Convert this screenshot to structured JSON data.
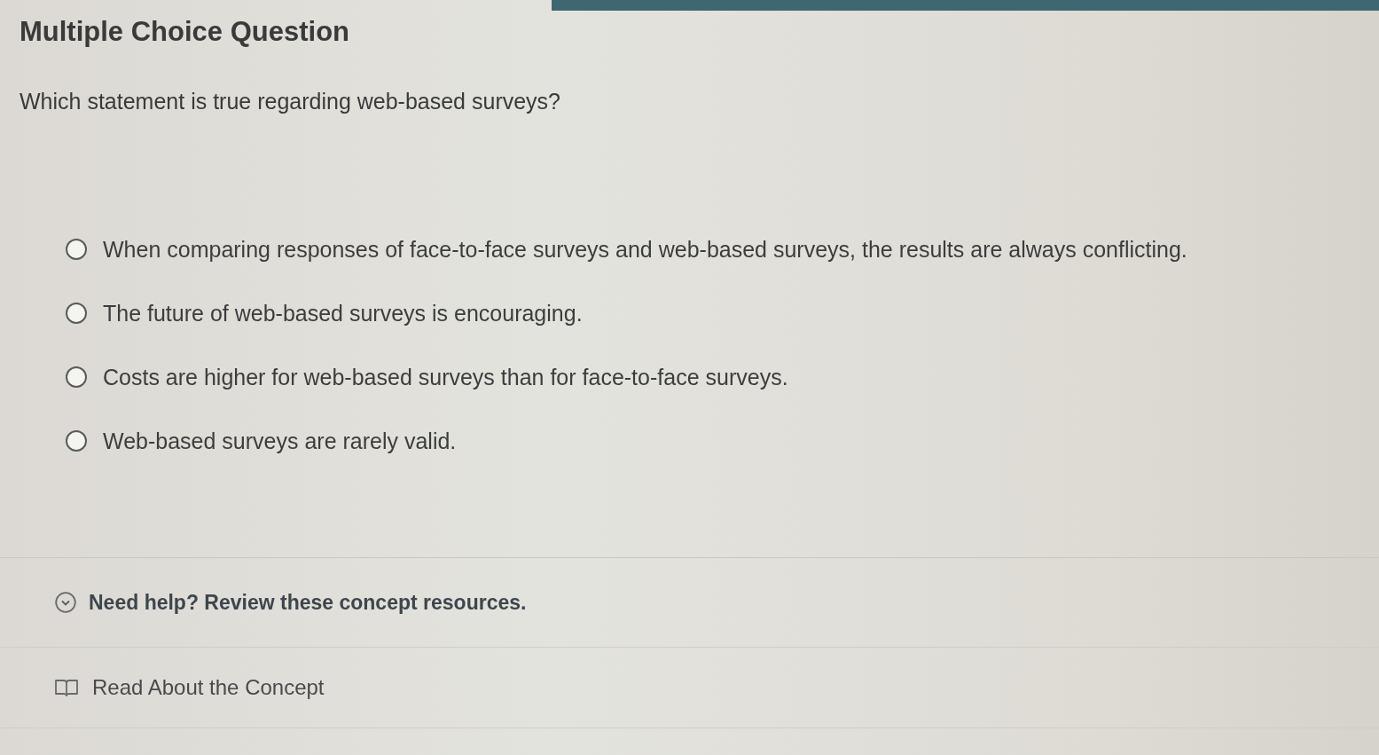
{
  "question": {
    "type_label": "Multiple Choice Question",
    "prompt": "Which statement is true regarding web-based surveys?",
    "options": [
      {
        "text": "When comparing responses of face-to-face surveys and web-based surveys, the results are always conflicting.",
        "selected": false
      },
      {
        "text": "The future of web-based surveys is encouraging.",
        "selected": false
      },
      {
        "text": "Costs are higher for web-based surveys than for face-to-face surveys.",
        "selected": false
      },
      {
        "text": "Web-based surveys are rarely valid.",
        "selected": false
      }
    ]
  },
  "help": {
    "title": "Need help? Review these concept resources.",
    "resources": [
      {
        "label": "Read About the Concept"
      }
    ]
  }
}
